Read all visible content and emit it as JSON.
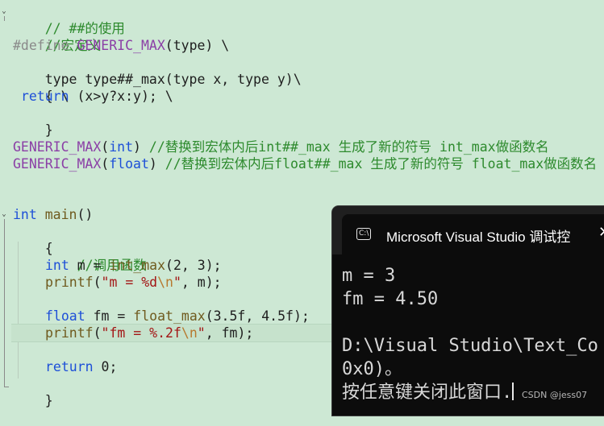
{
  "code": {
    "l1": "// ##的使用",
    "l2": "//宏定义",
    "l3_define": "#define",
    "l3_name": "GENERIC_MAX",
    "l3_rest": "(type) \\",
    "l4": "type type##_max(type x, type y)\\",
    "l5": "{ \\",
    "l6_kw": "return",
    "l6_rest": " (x>y?x:y); \\",
    "l7": "}",
    "l9_macro": "GENERIC_MAX",
    "l9_arg_open": "(",
    "l9_arg": "int",
    "l9_arg_close": ") ",
    "l9_comment": "//替换到宏体内后int##_max 生成了新的符号 int_max做函数名",
    "l10_macro": "GENERIC_MAX",
    "l10_arg_open": "(",
    "l10_arg": "float",
    "l10_arg_close": ") ",
    "l10_comment": "//替换到宏体内后float##_max 生成了新的符号 float_max做函数名",
    "l13_kw": "int",
    "l13_name": " main",
    "l13_rest": "()",
    "l14": "{",
    "l15": "//调用函数",
    "l16_kw": "int",
    "l16_var": " m = ",
    "l16_func": "int_max",
    "l16_rest": "(2, 3);",
    "l17_func": "printf",
    "l17_open": "(",
    "l17_str1": "\"m = %d",
    "l17_esc": "\\n",
    "l17_str2": "\"",
    "l17_rest": ", m);",
    "l19_kw": "float",
    "l19_var": " fm = ",
    "l19_func": "float_max",
    "l19_rest": "(3.5f, 4.5f);",
    "l20_func": "printf",
    "l20_open": "(",
    "l20_str1": "\"fm = %.2f",
    "l20_esc": "\\n",
    "l20_str2": "\"",
    "l20_rest": ", fm);",
    "l22_kw": "return",
    "l22_rest": " 0;",
    "l23": "}"
  },
  "console": {
    "title": "Microsoft Visual Studio 调试控",
    "close_glyph": "✕",
    "icon_glyph": "C:\\",
    "out1": "m = 3",
    "out2": "fm = 4.50",
    "out4": "D:\\Visual Studio\\Text_Co",
    "out5": "0x0)。",
    "out6": "按任意键关闭此窗口."
  },
  "watermark": "CSDN @jess07",
  "colors": {
    "editor_bg": "#cde8d4",
    "comment": "#2d8a2d",
    "keyword": "#1d4fd8",
    "macro": "#8b3fa6",
    "console_bg": "#0c0c0c"
  }
}
